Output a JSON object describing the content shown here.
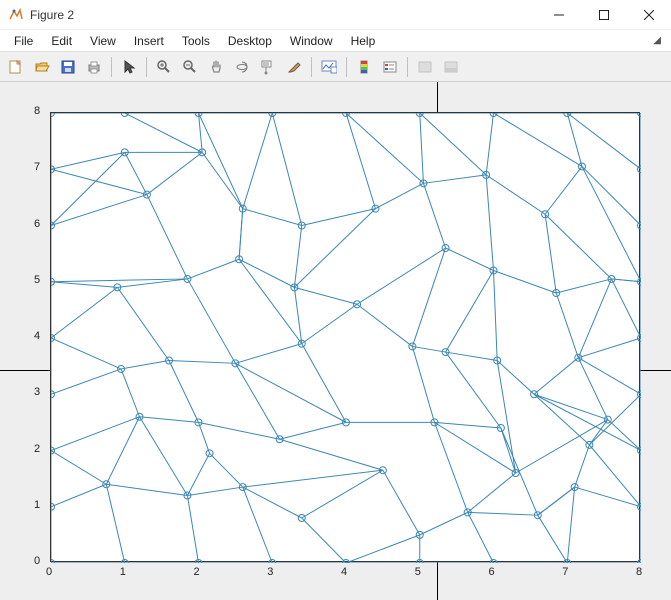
{
  "window": {
    "title": "Figure 2"
  },
  "menu": {
    "file": "File",
    "edit": "Edit",
    "view": "View",
    "insert": "Insert",
    "tools": "Tools",
    "desktop": "Desktop",
    "window": "Window",
    "help": "Help"
  },
  "toolbar_icons": {
    "new": "new-figure-icon",
    "open": "open-icon",
    "save": "save-icon",
    "print": "print-icon",
    "pointer": "pointer-icon",
    "zoomin": "zoom-in-icon",
    "zoomout": "zoom-out-icon",
    "pan": "pan-icon",
    "rotate": "rotate3d-icon",
    "datatip": "data-cursor-icon",
    "brush": "brush-icon",
    "link": "link-icon",
    "colorbar": "colorbar-icon",
    "legend": "legend-icon",
    "hide": "hide-plot-icon",
    "prop": "property-editor-icon"
  },
  "chart_data": {
    "type": "scatter",
    "title": "",
    "xlabel": "",
    "ylabel": "",
    "xlim": [
      0,
      8
    ],
    "ylim": [
      0,
      8
    ],
    "xticks": [
      0,
      1,
      2,
      3,
      4,
      5,
      6,
      7,
      8
    ],
    "yticks": [
      0,
      1,
      2,
      3,
      4,
      5,
      6,
      7,
      8
    ],
    "line_color": "#3c87b5",
    "marker": "o",
    "nodes": [
      [
        0,
        0
      ],
      [
        0,
        1
      ],
      [
        0,
        2
      ],
      [
        0,
        3
      ],
      [
        0,
        4
      ],
      [
        0,
        5
      ],
      [
        0,
        6
      ],
      [
        0,
        7
      ],
      [
        0,
        8
      ],
      [
        1,
        0
      ],
      [
        2,
        0
      ],
      [
        3,
        0
      ],
      [
        4,
        0
      ],
      [
        5,
        0
      ],
      [
        6,
        0
      ],
      [
        7,
        0
      ],
      [
        8,
        0
      ],
      [
        8,
        1
      ],
      [
        8,
        2
      ],
      [
        8,
        3
      ],
      [
        8,
        4
      ],
      [
        8,
        5
      ],
      [
        8,
        6
      ],
      [
        8,
        7
      ],
      [
        8,
        8
      ],
      [
        1,
        8
      ],
      [
        2,
        8
      ],
      [
        3,
        8
      ],
      [
        4,
        8
      ],
      [
        5,
        8
      ],
      [
        6,
        8
      ],
      [
        7,
        8
      ],
      [
        0.75,
        1.4
      ],
      [
        1.85,
        1.2
      ],
      [
        2.6,
        1.35
      ],
      [
        3.4,
        0.8
      ],
      [
        5.0,
        0.5
      ],
      [
        5.65,
        0.9
      ],
      [
        6.6,
        0.85
      ],
      [
        7.1,
        1.35
      ],
      [
        1.2,
        2.6
      ],
      [
        2.0,
        2.5
      ],
      [
        3.1,
        2.2
      ],
      [
        4.0,
        2.5
      ],
      [
        5.2,
        2.5
      ],
      [
        6.3,
        1.6
      ],
      [
        7.55,
        2.55
      ],
      [
        0.95,
        3.45
      ],
      [
        1.6,
        3.6
      ],
      [
        2.5,
        3.55
      ],
      [
        3.4,
        3.9
      ],
      [
        4.15,
        4.6
      ],
      [
        4.9,
        3.85
      ],
      [
        5.35,
        3.75
      ],
      [
        6.05,
        3.6
      ],
      [
        6.55,
        3.0
      ],
      [
        7.15,
        3.65
      ],
      [
        0.9,
        4.9
      ],
      [
        1.85,
        5.05
      ],
      [
        2.55,
        5.4
      ],
      [
        3.3,
        4.9
      ],
      [
        5.35,
        5.6
      ],
      [
        6.0,
        5.2
      ],
      [
        6.85,
        4.8
      ],
      [
        7.6,
        5.05
      ],
      [
        1.3,
        6.55
      ],
      [
        2.05,
        7.3
      ],
      [
        2.6,
        6.3
      ],
      [
        3.4,
        6.0
      ],
      [
        4.4,
        6.3
      ],
      [
        5.05,
        6.75
      ],
      [
        5.9,
        6.9
      ],
      [
        6.7,
        6.2
      ],
      [
        7.2,
        7.05
      ],
      [
        1.0,
        7.3
      ],
      [
        7.3,
        2.1
      ],
      [
        2.15,
        1.95
      ],
      [
        4.5,
        1.65
      ],
      [
        6.1,
        2.4
      ]
    ],
    "edges": [
      [
        0,
        9
      ],
      [
        9,
        10
      ],
      [
        10,
        11
      ],
      [
        11,
        12
      ],
      [
        12,
        13
      ],
      [
        13,
        14
      ],
      [
        14,
        15
      ],
      [
        15,
        16
      ],
      [
        0,
        1
      ],
      [
        1,
        2
      ],
      [
        2,
        3
      ],
      [
        3,
        4
      ],
      [
        4,
        5
      ],
      [
        5,
        6
      ],
      [
        6,
        7
      ],
      [
        7,
        8
      ],
      [
        16,
        17
      ],
      [
        17,
        18
      ],
      [
        18,
        19
      ],
      [
        19,
        20
      ],
      [
        20,
        21
      ],
      [
        21,
        22
      ],
      [
        22,
        23
      ],
      [
        23,
        24
      ],
      [
        8,
        25
      ],
      [
        25,
        26
      ],
      [
        26,
        27
      ],
      [
        27,
        28
      ],
      [
        28,
        29
      ],
      [
        29,
        30
      ],
      [
        30,
        31
      ],
      [
        31,
        24
      ],
      [
        1,
        32
      ],
      [
        9,
        32
      ],
      [
        32,
        33
      ],
      [
        10,
        33
      ],
      [
        33,
        34
      ],
      [
        34,
        35
      ],
      [
        11,
        34
      ],
      [
        35,
        12
      ],
      [
        12,
        36
      ],
      [
        35,
        77
      ],
      [
        36,
        13
      ],
      [
        36,
        37
      ],
      [
        37,
        14
      ],
      [
        37,
        45
      ],
      [
        37,
        38
      ],
      [
        38,
        15
      ],
      [
        38,
        39
      ],
      [
        39,
        15
      ],
      [
        39,
        17
      ],
      [
        2,
        32
      ],
      [
        32,
        40
      ],
      [
        40,
        33
      ],
      [
        40,
        41
      ],
      [
        41,
        76
      ],
      [
        76,
        33
      ],
      [
        76,
        34
      ],
      [
        41,
        42
      ],
      [
        42,
        43
      ],
      [
        42,
        77
      ],
      [
        77,
        34
      ],
      [
        77,
        36
      ],
      [
        43,
        44
      ],
      [
        44,
        37
      ],
      [
        44,
        45
      ],
      [
        45,
        78
      ],
      [
        78,
        38
      ],
      [
        45,
        46
      ],
      [
        46,
        75
      ],
      [
        75,
        39
      ],
      [
        75,
        17
      ],
      [
        46,
        18
      ],
      [
        3,
        47
      ],
      [
        47,
        40
      ],
      [
        40,
        2
      ],
      [
        47,
        48
      ],
      [
        48,
        41
      ],
      [
        48,
        49
      ],
      [
        49,
        42
      ],
      [
        49,
        43
      ],
      [
        49,
        50
      ],
      [
        50,
        43
      ],
      [
        50,
        51
      ],
      [
        51,
        52
      ],
      [
        52,
        53
      ],
      [
        52,
        44
      ],
      [
        44,
        78
      ],
      [
        53,
        54
      ],
      [
        53,
        78
      ],
      [
        54,
        55
      ],
      [
        55,
        46
      ],
      [
        55,
        75
      ],
      [
        54,
        45
      ],
      [
        55,
        56
      ],
      [
        56,
        46
      ],
      [
        56,
        19
      ],
      [
        56,
        20
      ],
      [
        19,
        75
      ],
      [
        4,
        47
      ],
      [
        4,
        57
      ],
      [
        57,
        48
      ],
      [
        57,
        58
      ],
      [
        58,
        49
      ],
      [
        58,
        59
      ],
      [
        59,
        50
      ],
      [
        59,
        60
      ],
      [
        60,
        50
      ],
      [
        60,
        51
      ],
      [
        51,
        61
      ],
      [
        61,
        52
      ],
      [
        61,
        62
      ],
      [
        62,
        53
      ],
      [
        62,
        54
      ],
      [
        62,
        63
      ],
      [
        63,
        56
      ],
      [
        63,
        64
      ],
      [
        64,
        56
      ],
      [
        64,
        20
      ],
      [
        64,
        21
      ],
      [
        5,
        57
      ],
      [
        5,
        58
      ],
      [
        58,
        65
      ],
      [
        6,
        65
      ],
      [
        65,
        66
      ],
      [
        66,
        67
      ],
      [
        67,
        59
      ],
      [
        67,
        68
      ],
      [
        68,
        60
      ],
      [
        60,
        69
      ],
      [
        68,
        69
      ],
      [
        69,
        70
      ],
      [
        70,
        61
      ],
      [
        70,
        71
      ],
      [
        71,
        62
      ],
      [
        71,
        72
      ],
      [
        72,
        63
      ],
      [
        72,
        64
      ],
      [
        72,
        73
      ],
      [
        73,
        22
      ],
      [
        73,
        21
      ],
      [
        21,
        64
      ],
      [
        6,
        74
      ],
      [
        74,
        65
      ],
      [
        7,
        74
      ],
      [
        74,
        66
      ],
      [
        8,
        25
      ],
      [
        25,
        66
      ],
      [
        26,
        66
      ],
      [
        26,
        67
      ],
      [
        27,
        67
      ],
      [
        27,
        68
      ],
      [
        28,
        69
      ],
      [
        28,
        70
      ],
      [
        29,
        70
      ],
      [
        29,
        71
      ],
      [
        30,
        71
      ],
      [
        30,
        73
      ],
      [
        31,
        73
      ],
      [
        31,
        23
      ],
      [
        7,
        65
      ],
      [
        59,
        67
      ],
      [
        18,
        55
      ],
      [
        39,
        38
      ]
    ]
  }
}
